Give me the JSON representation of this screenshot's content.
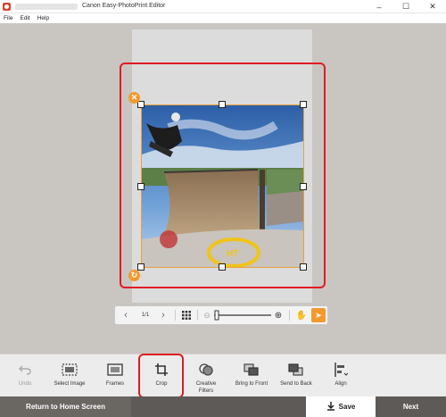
{
  "window": {
    "title": "Canon Easy-PhotoPrint Editor",
    "minimize_icon": "minimize-icon",
    "maximize_icon": "maximize-icon",
    "close_icon": "close-icon"
  },
  "menu": {
    "items": [
      "File",
      "Edit",
      "Help"
    ]
  },
  "canvas": {
    "delete_icon": "close-circle-icon",
    "rotate_icon": "rotate-circle-icon"
  },
  "viewbar": {
    "page_indicator": "1/1",
    "icons": [
      "prev-page-icon",
      "next-page-icon",
      "grid-view-icon",
      "zoom-out-icon",
      "zoom-slider",
      "zoom-in-icon",
      "hand-tool-icon",
      "pointer-tool-icon"
    ],
    "active_color": "#f29a2e"
  },
  "toolbar": {
    "undo": "Undo",
    "select_image": "Select Image",
    "frames": "Frames",
    "crop": "Crop",
    "creative_filters_1": "Creative",
    "creative_filters_2": "Filters",
    "bring_to_front": "Bring to Front",
    "send_to_back": "Send to Back",
    "align": "Align"
  },
  "bottom": {
    "home": "Return to Home Screen",
    "save": "Save",
    "next": "Next"
  },
  "colors": {
    "highlight": "#e01b24",
    "accent": "#f29a2e",
    "workspace": "#c9c5c1",
    "bottom_bar": "#5e5a57"
  }
}
